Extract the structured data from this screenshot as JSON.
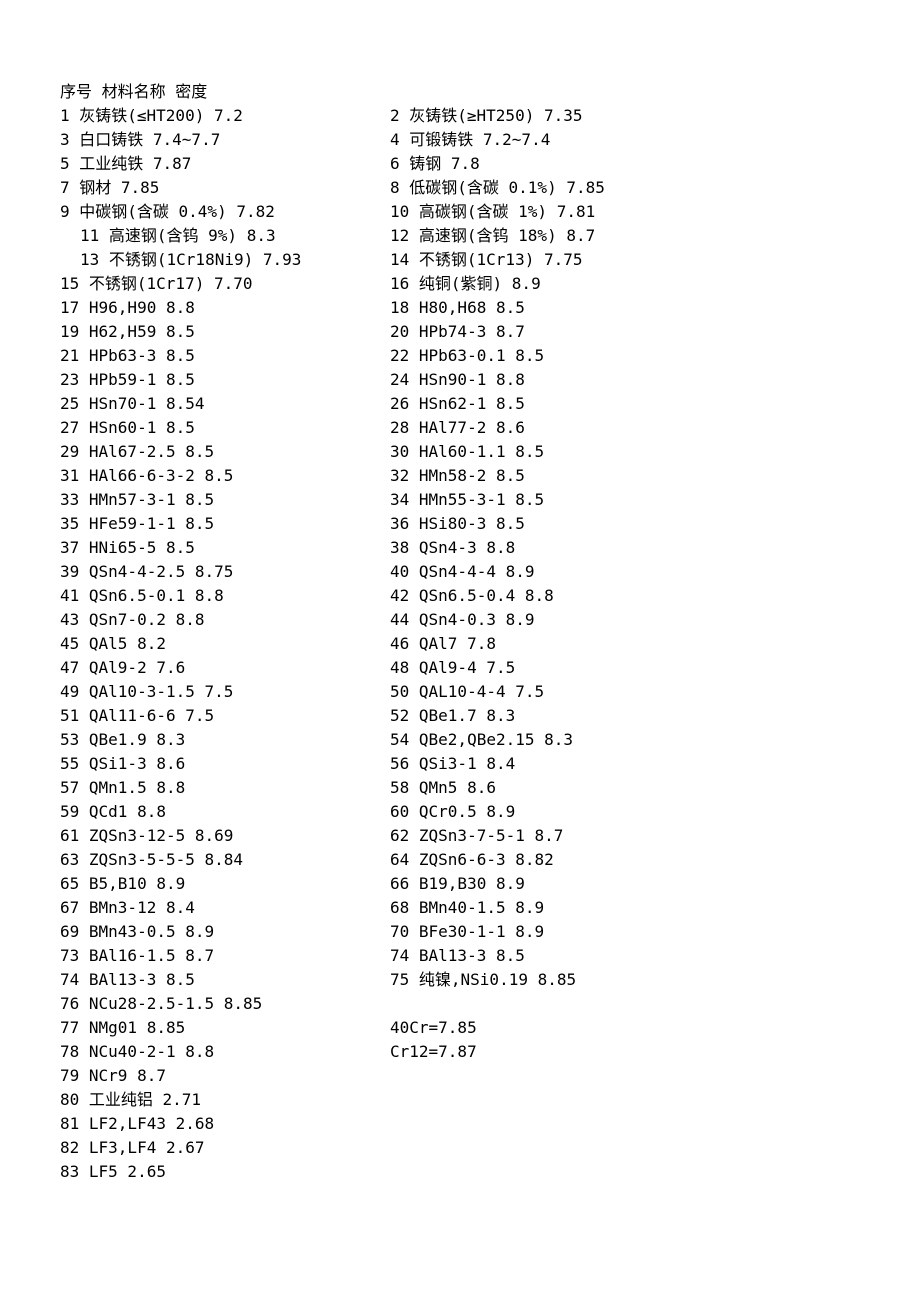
{
  "header": "序号 材料名称 密度",
  "rows": [
    {
      "left": "1 灰铸铁(≤HT200) 7.2",
      "right": "2 灰铸铁(≥HT250) 7.35"
    },
    {
      "left": "3 白口铸铁 7.4~7.7",
      "right": "4 可锻铸铁 7.2~7.4"
    },
    {
      "left": "5 工业纯铁 7.87",
      "right": "6 铸钢 7.8"
    },
    {
      "left": "7 钢材 7.85",
      "right": "8 低碳钢(含碳 0.1%) 7.85"
    },
    {
      "left": "9 中碳钢(含碳 0.4%) 7.82",
      "right": "10 高碳钢(含碳 1%) 7.81"
    },
    {
      "left": "11 高速钢(含钨 9%) 8.3",
      "right": "12 高速钢(含钨 18%) 8.7",
      "indent_left": true
    },
    {
      "left": "13 不锈钢(1Cr18Ni9) 7.93",
      "right": "14 不锈钢(1Cr13) 7.75",
      "indent_left": true
    },
    {
      "left": "15 不锈钢(1Cr17) 7.70",
      "right": "16 纯铜(紫铜) 8.9"
    },
    {
      "left": "17 H96,H90 8.8",
      "right": "18 H80,H68 8.5"
    },
    {
      "left": "19 H62,H59 8.5",
      "right": "20 HPb74-3 8.7"
    },
    {
      "left": "21 HPb63-3 8.5",
      "right": "22 HPb63-0.1 8.5"
    },
    {
      "left": "23 HPb59-1 8.5",
      "right": "24 HSn90-1 8.8"
    },
    {
      "left": "25 HSn70-1 8.54",
      "right": "26 HSn62-1 8.5"
    },
    {
      "left": "27 HSn60-1 8.5",
      "right": "28 HAl77-2 8.6"
    },
    {
      "left": "29 HAl67-2.5 8.5",
      "right": "30 HAl60-1.1 8.5"
    },
    {
      "left": "31 HAl66-6-3-2 8.5",
      "right": "32 HMn58-2 8.5"
    },
    {
      "left": "33 HMn57-3-1 8.5",
      "right": "34 HMn55-3-1 8.5"
    },
    {
      "left": "35 HFe59-1-1 8.5",
      "right": "36 HSi80-3 8.5"
    },
    {
      "left": "37 HNi65-5 8.5",
      "right": "38 QSn4-3 8.8"
    },
    {
      "left": "39 QSn4-4-2.5 8.75",
      "right": "40 QSn4-4-4 8.9"
    },
    {
      "left": "41 QSn6.5-0.1 8.8",
      "right": "42 QSn6.5-0.4 8.8"
    },
    {
      "left": "43 QSn7-0.2 8.8",
      "right": "44 QSn4-0.3 8.9"
    },
    {
      "left": "45 QAl5 8.2",
      "right": "46 QAl7 7.8"
    },
    {
      "left": "47 QAl9-2 7.6",
      "right": "48 QAl9-4 7.5"
    },
    {
      "left": "49 QAl10-3-1.5 7.5",
      "right": "50 QAL10-4-4 7.5"
    },
    {
      "left": "51 QAl11-6-6 7.5",
      "right": "52 QBe1.7 8.3"
    },
    {
      "left": "53 QBe1.9 8.3",
      "right": "54 QBe2,QBe2.15 8.3"
    },
    {
      "left": "55 QSi1-3 8.6",
      "right": "56 QSi3-1 8.4"
    },
    {
      "left": "57 QMn1.5 8.8",
      "right": "58 QMn5 8.6"
    },
    {
      "left": "59 QCd1 8.8",
      "right": "60 QCr0.5 8.9"
    },
    {
      "left": "61 ZQSn3-12-5 8.69",
      "right": "62 ZQSn3-7-5-1 8.7"
    },
    {
      "left": "63 ZQSn3-5-5-5 8.84",
      "right": "64 ZQSn6-6-3 8.82"
    },
    {
      "left": "65 B5,B10 8.9",
      "right": "66 B19,B30 8.9"
    },
    {
      "left": "67 BMn3-12 8.4",
      "right": "68 BMn40-1.5 8.9"
    },
    {
      "left": "69 BMn43-0.5 8.9",
      "right": "70 BFe30-1-1 8.9"
    },
    {
      "left": "73 BAl16-1.5 8.7",
      "right": "74 BAl13-3 8.5"
    },
    {
      "left": "74 BAl13-3 8.5",
      "right": "75 纯镍,NSi0.19 8.85"
    },
    {
      "left": "76 NCu28-2.5-1.5 8.85",
      "right": ""
    },
    {
      "left": "77 NMg01 8.85",
      "right": "40Cr=7.85"
    },
    {
      "left": "78 NCu40-2-1 8.8",
      "right": "Cr12=7.87"
    },
    {
      "left": "79 NCr9 8.7",
      "right": ""
    },
    {
      "left": "80 工业纯铝 2.71",
      "right": ""
    },
    {
      "left": "81 LF2,LF43 2.68",
      "right": ""
    },
    {
      "left": "82 LF3,LF4 2.67",
      "right": ""
    },
    {
      "left": "83 LF5 2.65",
      "right": ""
    }
  ]
}
